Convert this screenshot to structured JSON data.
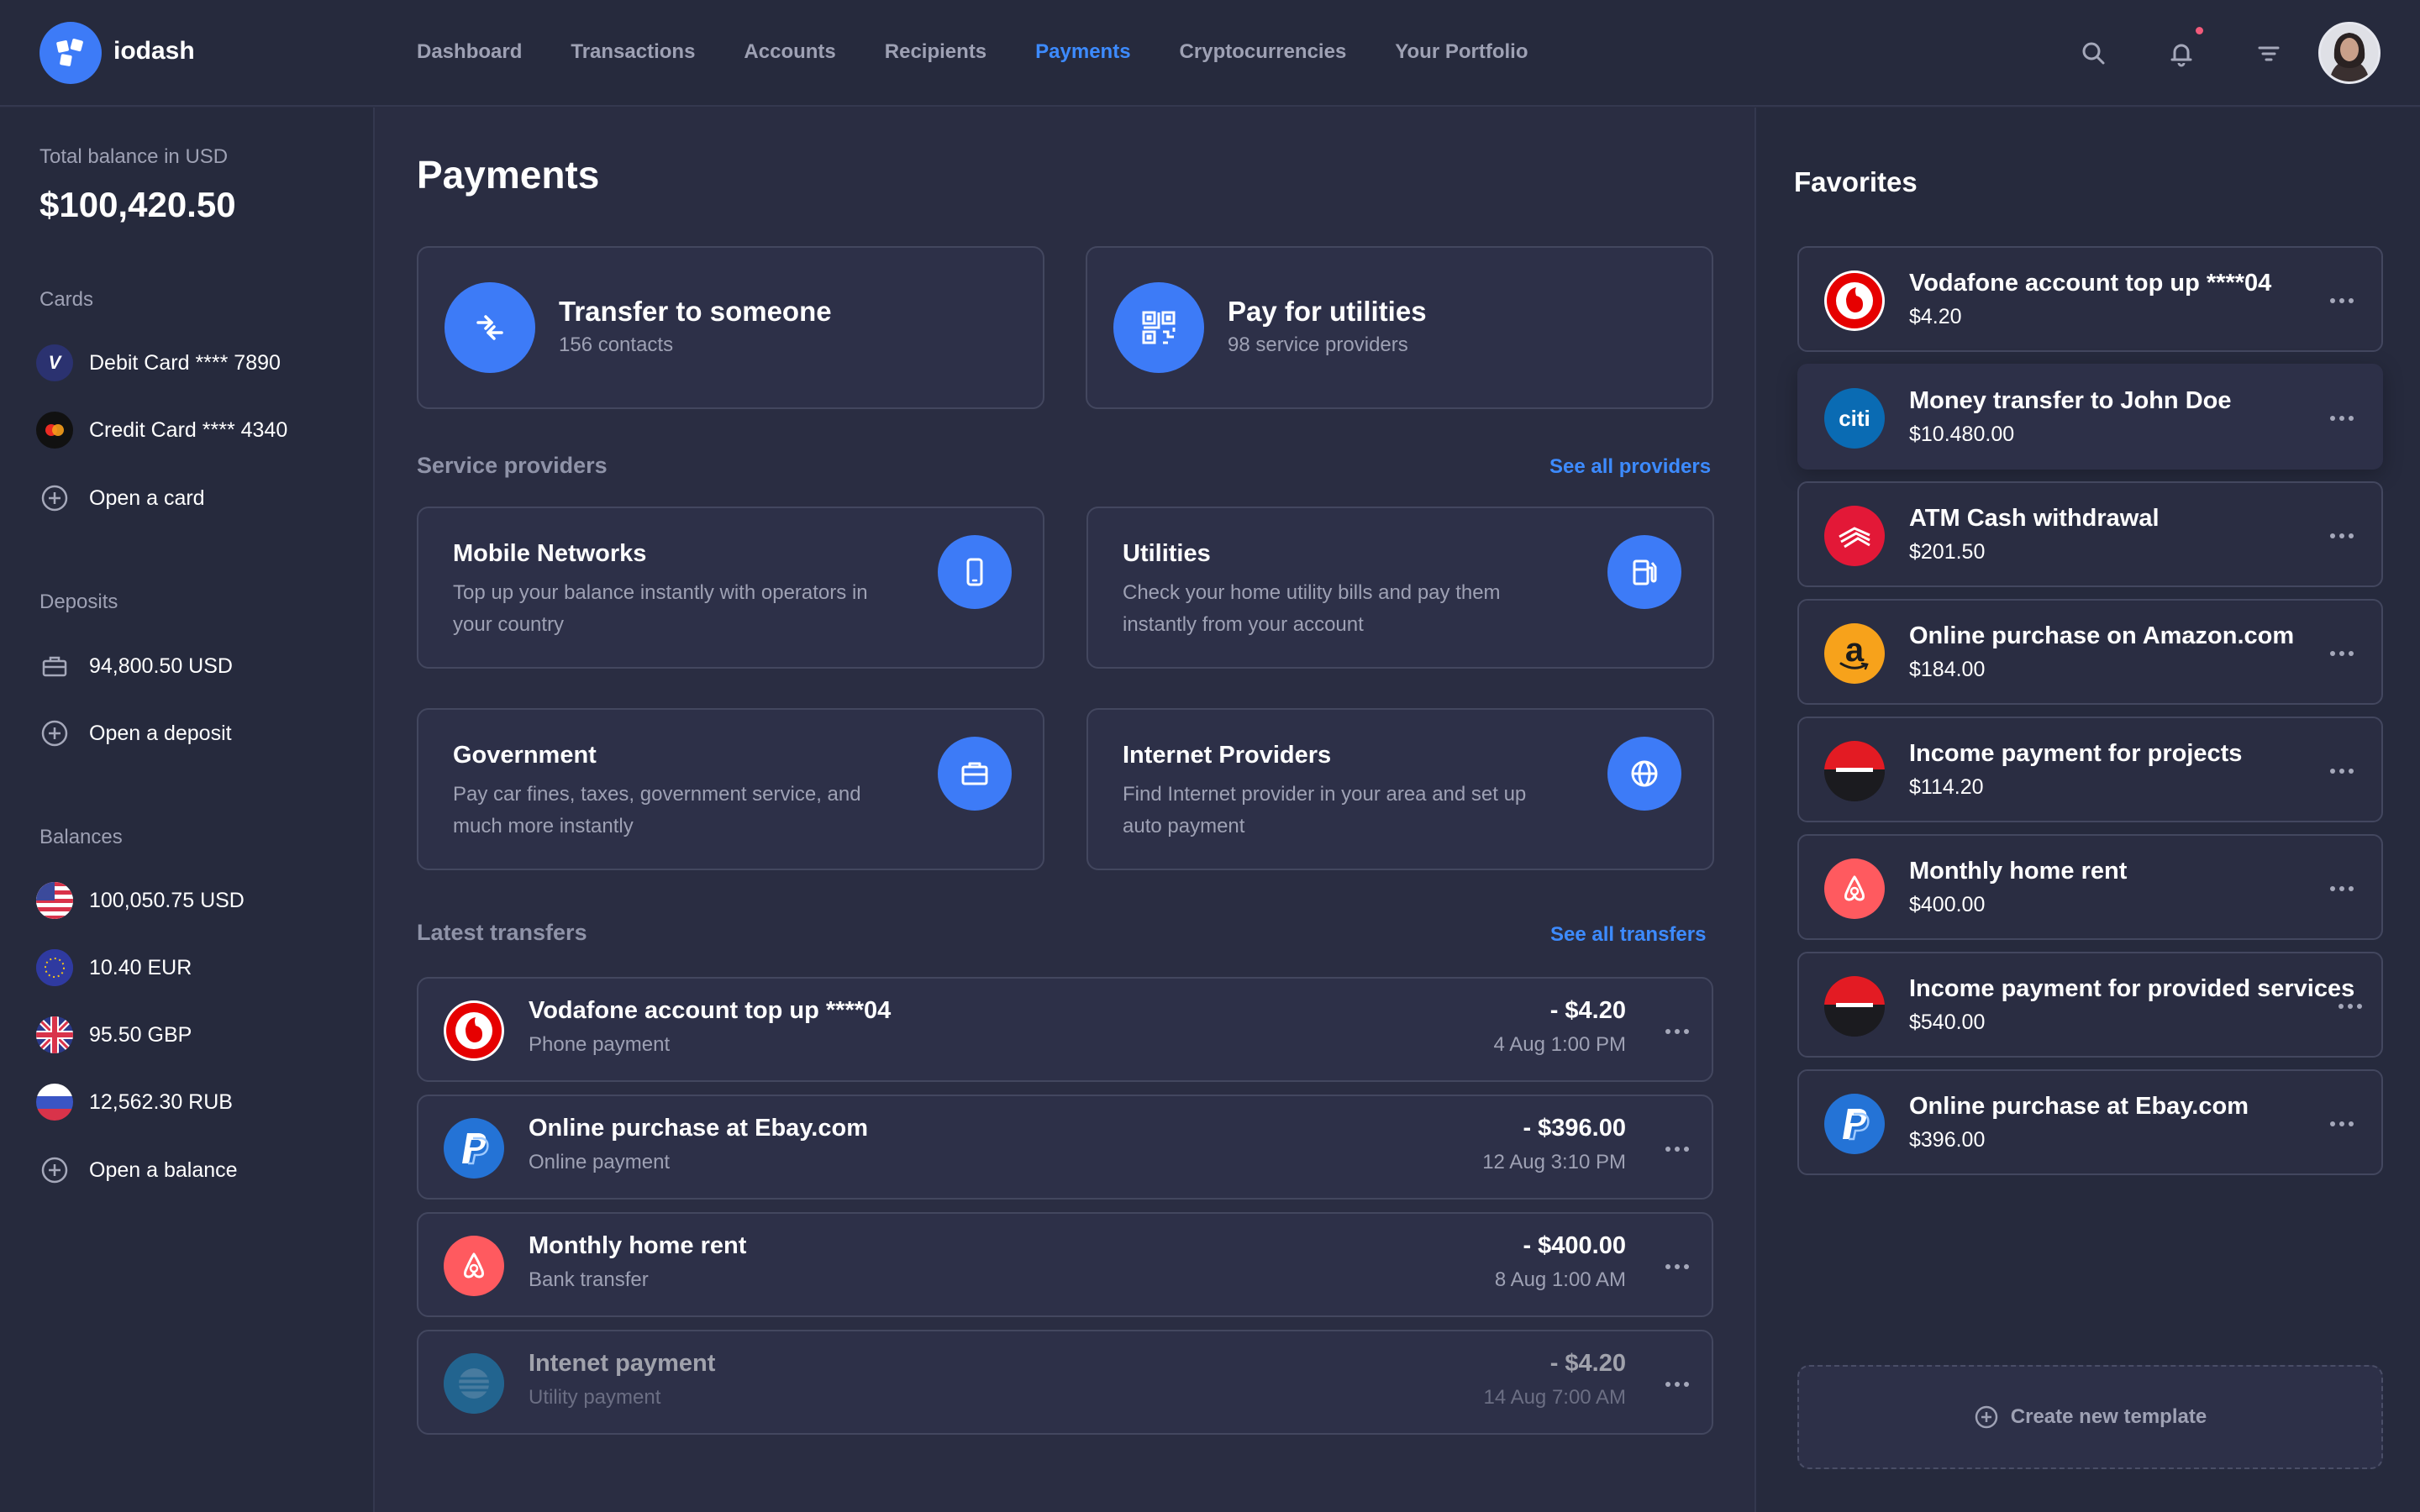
{
  "app": {
    "name": "iodash"
  },
  "nav": {
    "items": [
      "Dashboard",
      "Transactions",
      "Accounts",
      "Recipients",
      "Payments",
      "Cryptocurrencies",
      "Your Portfolio"
    ],
    "active": "Payments"
  },
  "colors": {
    "accent": "#3d7bf7",
    "link": "#3d8bff",
    "background": "#2a2d42",
    "panel": "#262a3d"
  },
  "sidebar": {
    "total_label": "Total balance in USD",
    "total_value": "$100,420.50",
    "cards_label": "Cards",
    "cards": [
      {
        "label": "Debit Card **** 7890",
        "icon": "visa-icon"
      },
      {
        "label": "Credit Card **** 4340",
        "icon": "mastercard-icon"
      }
    ],
    "open_card": "Open a card",
    "deposits_label": "Deposits",
    "deposit_value": "94,800.50 USD",
    "open_deposit": "Open a deposit",
    "balances_label": "Balances",
    "balances": [
      {
        "label": "100,050.75 USD",
        "icon": "us-flag-icon"
      },
      {
        "label": "10.40 EUR",
        "icon": "eu-flag-icon"
      },
      {
        "label": "95.50 GBP",
        "icon": "uk-flag-icon"
      },
      {
        "label": "12,562.30 RUB",
        "icon": "ru-flag-icon"
      }
    ],
    "open_balance": "Open a balance"
  },
  "main": {
    "title": "Payments",
    "actions": [
      {
        "title": "Transfer to someone",
        "sub": "156 contacts",
        "icon": "transfer-arrows-icon"
      },
      {
        "title": "Pay for utilities",
        "sub": "98 service providers",
        "icon": "qr-code-icon"
      }
    ],
    "providers_label": "Service providers",
    "providers_link": "See all providers",
    "providers": [
      {
        "title": "Mobile Networks",
        "desc": "Top up your balance instantly with operators in your country",
        "icon": "mobile-phone-icon"
      },
      {
        "title": "Utilities",
        "desc": "Check your home utility bills and pay them instantly from your account",
        "icon": "fuel-pump-icon"
      },
      {
        "title": "Government",
        "desc": "Pay car fines, taxes, government service, and much more instantly",
        "icon": "briefcase-icon"
      },
      {
        "title": "Internet Providers",
        "desc": "Find Internet provider in your area and set up auto payment",
        "icon": "globe-icon"
      }
    ],
    "transfers_label": "Latest transfers",
    "transfers_link": "See all transfers",
    "transfers": [
      {
        "title": "Vodafone account top up  ****04",
        "sub": "Phone payment",
        "amount": "- $4.20",
        "date": "4 Aug 1:00 PM",
        "logo": "vodafone-logo"
      },
      {
        "title": "Online purchase at Ebay.com",
        "sub": "Online payment",
        "amount": "- $396.00",
        "date": "12 Aug 3:10 PM",
        "logo": "paypal-logo"
      },
      {
        "title": "Monthly home rent",
        "sub": "Bank transfer",
        "amount": "- $400.00",
        "date": "8 Aug 1:00 AM",
        "logo": "airbnb-logo"
      },
      {
        "title": "Intenet payment",
        "sub": "Utility payment",
        "amount": "- $4.20",
        "date": "14 Aug 7:00 AM",
        "logo": "att-logo"
      }
    ]
  },
  "favorites": {
    "title": "Favorites",
    "items": [
      {
        "name": "Vodafone account top up  ****04",
        "amount": "$4.20",
        "logo": "vodafone-logo"
      },
      {
        "name": "Money transfer to John Doe",
        "amount": "$10.480.00",
        "logo": "citi-logo",
        "logo_text": "citi"
      },
      {
        "name": "ATM Cash withdrawal",
        "amount": "$201.50",
        "logo": "bank-of-america-logo"
      },
      {
        "name": "Online purchase on Amazon.com",
        "amount": "$184.00",
        "logo": "amazon-logo",
        "logo_text": "a"
      },
      {
        "name": "Income payment for projects",
        "amount": "$114.20",
        "logo": "bank-stripe-logo"
      },
      {
        "name": "Monthly home rent",
        "amount": "$400.00",
        "logo": "airbnb-logo"
      },
      {
        "name": "Income payment for provided services",
        "amount": "$540.00",
        "logo": "bank-stripe-logo"
      },
      {
        "name": "Online purchase at Ebay.com",
        "amount": "$396.00",
        "logo": "paypal-logo"
      }
    ],
    "create_template": "Create new template"
  }
}
